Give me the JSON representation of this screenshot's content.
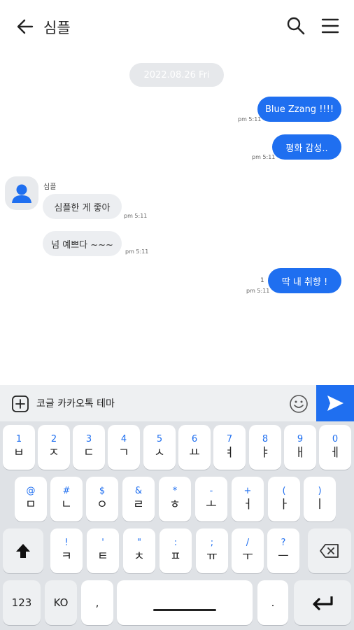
{
  "header": {
    "title": "심플",
    "back_icon": "arrow-left-icon",
    "search_icon": "search-icon",
    "menu_icon": "hamburger-menu-icon"
  },
  "date_chip": "2022.08.26 Fri",
  "messages": {
    "out1": {
      "text": "Blue Zzang !!!!",
      "time": "pm 5:11"
    },
    "out2": {
      "text": "평화 감성..",
      "time": "pm 5:11"
    },
    "sender_name": "심플",
    "in1": {
      "text": "심플한 게 좋아",
      "time": "pm 5:11"
    },
    "in2": {
      "text": "넘 예쁘다 ~~~",
      "time": "pm 5:11"
    },
    "out3": {
      "text": "딱 내 취향 !",
      "time": "pm 5:11",
      "unread": "1"
    }
  },
  "composer": {
    "placeholder": "코글 카카오톡 테마",
    "plus_icon": "plus-square-icon",
    "emoji_icon": "smiley-icon",
    "send_icon": "send-icon"
  },
  "keyboard": {
    "row1": [
      {
        "hint": "1",
        "main": "ㅂ"
      },
      {
        "hint": "2",
        "main": "ㅈ"
      },
      {
        "hint": "3",
        "main": "ㄷ"
      },
      {
        "hint": "4",
        "main": "ㄱ"
      },
      {
        "hint": "5",
        "main": "ㅅ"
      },
      {
        "hint": "6",
        "main": "ㅛ"
      },
      {
        "hint": "7",
        "main": "ㅕ"
      },
      {
        "hint": "8",
        "main": "ㅑ"
      },
      {
        "hint": "9",
        "main": "ㅐ"
      },
      {
        "hint": "0",
        "main": "ㅔ"
      }
    ],
    "row2": [
      {
        "hint": "@",
        "main": "ㅁ"
      },
      {
        "hint": "#",
        "main": "ㄴ"
      },
      {
        "hint": "$",
        "main": "ㅇ"
      },
      {
        "hint": "&",
        "main": "ㄹ"
      },
      {
        "hint": "*",
        "main": "ㅎ"
      },
      {
        "hint": "-",
        "main": "ㅗ"
      },
      {
        "hint": "+",
        "main": "ㅓ"
      },
      {
        "hint": "(",
        "main": "ㅏ"
      },
      {
        "hint": ")",
        "main": "ㅣ"
      }
    ],
    "row3": [
      {
        "hint": "!",
        "main": "ㅋ"
      },
      {
        "hint": "'",
        "main": "ㅌ"
      },
      {
        "hint": "\"",
        "main": "ㅊ"
      },
      {
        "hint": ":",
        "main": "ㅍ"
      },
      {
        "hint": ";",
        "main": "ㅠ"
      },
      {
        "hint": "/",
        "main": "ㅜ"
      },
      {
        "hint": "?",
        "main": "ㅡ"
      }
    ],
    "shift_icon": "shift-arrow-icon",
    "backspace_icon": "backspace-icon",
    "num_label": "123",
    "lang_label": "KO",
    "comma_label": ",",
    "period_label": ".",
    "enter_icon": "enter-icon"
  }
}
